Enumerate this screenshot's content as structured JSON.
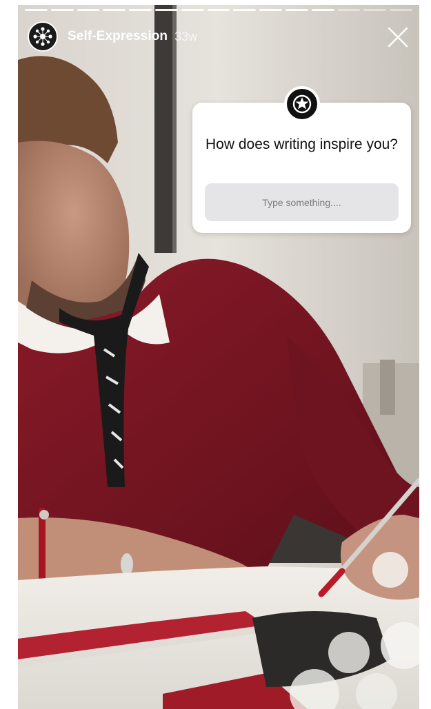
{
  "story": {
    "segments_total": 15,
    "segments_viewed": 12
  },
  "header": {
    "account_name": "Self-Expression",
    "post_age": "33w",
    "avatar_icon": "network-logo-icon",
    "close_icon": "close-icon"
  },
  "question_sticker": {
    "badge_icon": "brand-star-icon",
    "question": "How does writing inspire you?",
    "answer_placeholder": "Type something...."
  },
  "colors": {
    "sweater": "#7a1422",
    "paper": "#f2efea",
    "sticker_bg": "#ffffff",
    "field_bg": "#e5e5e7"
  }
}
